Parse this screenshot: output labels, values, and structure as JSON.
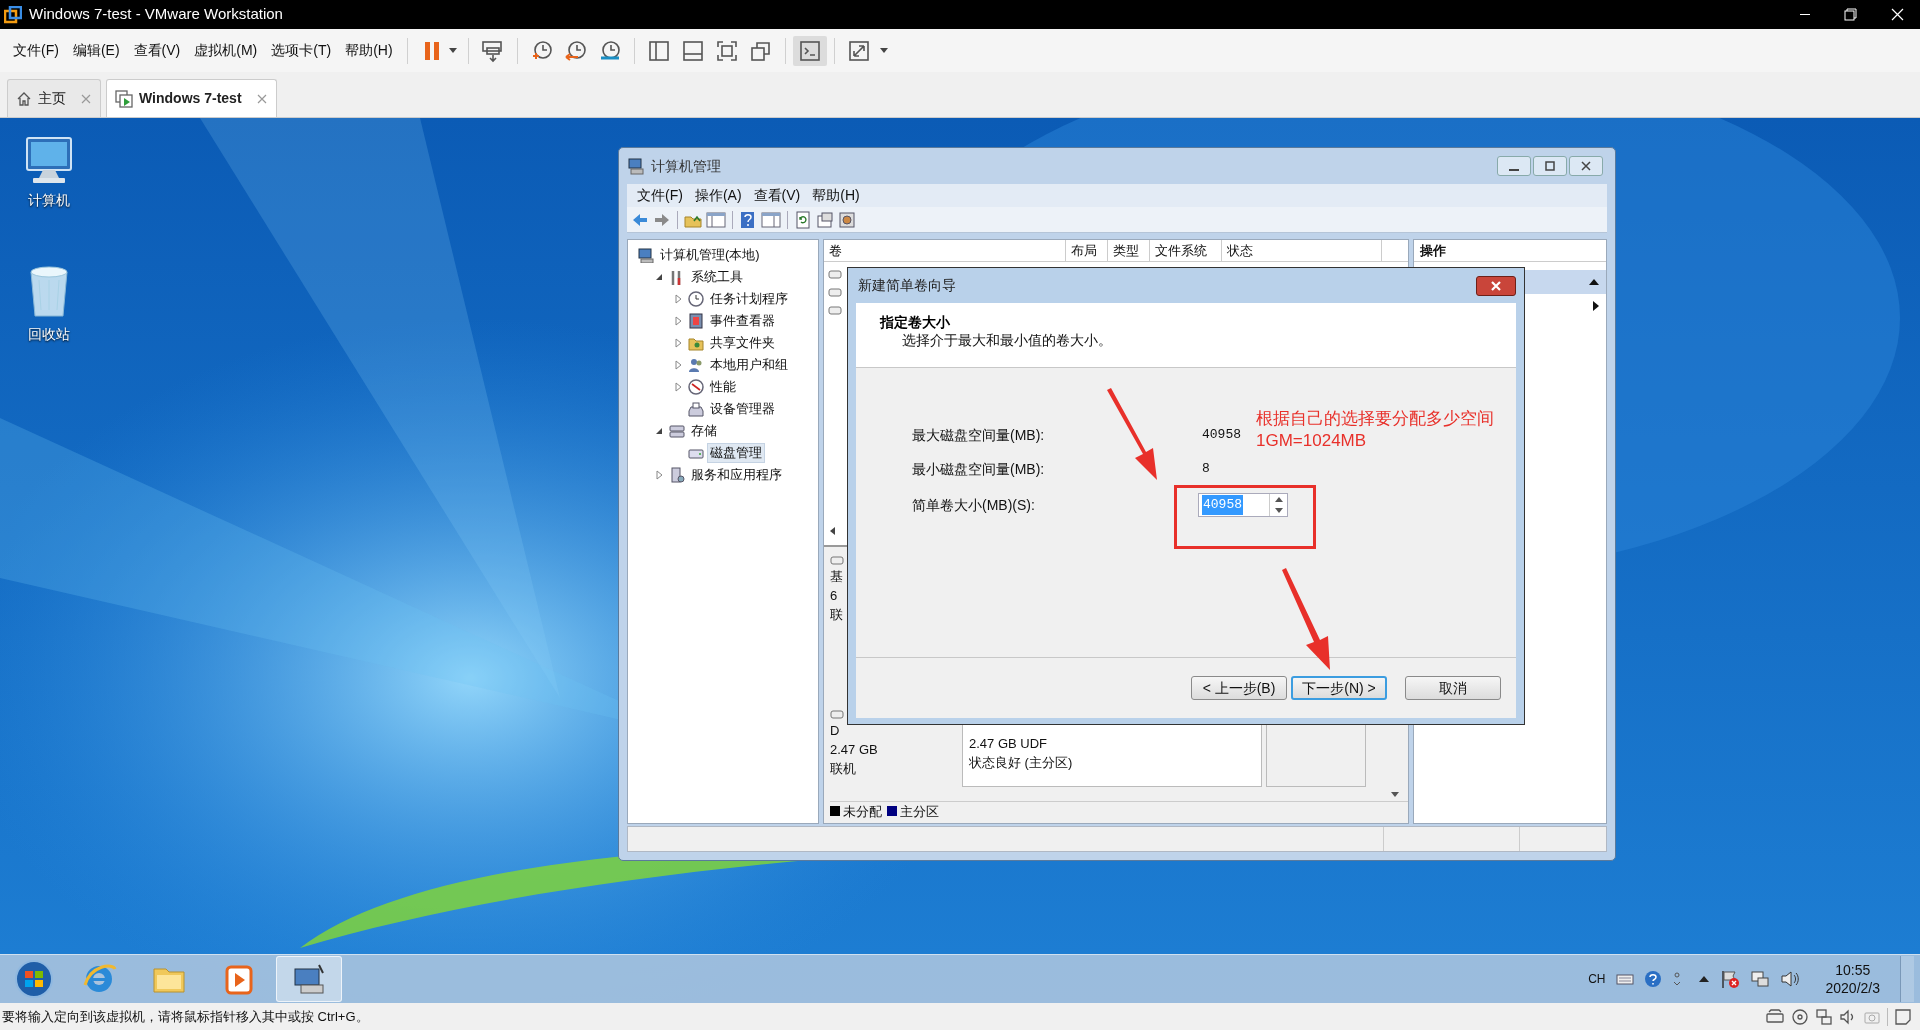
{
  "window": {
    "title": "Windows 7-test - VMware Workstation"
  },
  "menu": [
    "文件(F)",
    "编辑(E)",
    "查看(V)",
    "虚拟机(M)",
    "选项卡(T)",
    "帮助(H)"
  ],
  "tabs": [
    {
      "label": "主页",
      "selected": false
    },
    {
      "label": "Windows 7-test",
      "selected": true
    }
  ],
  "desktop_icons": [
    {
      "label": "计算机",
      "kind": "computer"
    },
    {
      "label": "回收站",
      "kind": "recycle"
    }
  ],
  "computer_management": {
    "title": "计算机管理",
    "menu": [
      "文件(F)",
      "操作(A)",
      "查看(V)",
      "帮助(H)"
    ],
    "tree": [
      {
        "label": "计算机管理(本地)",
        "kind": "computer",
        "selected": false,
        "children": [
          {
            "label": "系统工具",
            "kind": "tools",
            "expanded": true,
            "selected": false,
            "children": [
              {
                "label": "任务计划程序",
                "kind": "clock",
                "expanded": false,
                "selected": false
              },
              {
                "label": "事件查看器",
                "kind": "log",
                "expanded": false,
                "selected": false
              },
              {
                "label": "共享文件夹",
                "kind": "share",
                "expanded": false,
                "selected": false
              },
              {
                "label": "本地用户和组",
                "kind": "users",
                "expanded": false,
                "selected": false
              },
              {
                "label": "性能",
                "kind": "perf",
                "expanded": false,
                "selected": false
              },
              {
                "label": "设备管理器",
                "kind": "device",
                "selected": false
              }
            ]
          },
          {
            "label": "存储",
            "kind": "storage",
            "expanded": true,
            "selected": false,
            "children": [
              {
                "label": "磁盘管理",
                "kind": "disk",
                "selected": true
              }
            ]
          },
          {
            "label": "服务和应用程序",
            "kind": "services",
            "expanded": false,
            "selected": false
          }
        ]
      }
    ],
    "columns": [
      "卷",
      "布局",
      "类型",
      "文件系统",
      "状态"
    ],
    "disks": [
      {
        "lines": [
          "基",
          "6",
          "联"
        ]
      },
      {
        "lines": [
          "D",
          "2.47 GB",
          "联机"
        ],
        "partition": [
          "2.47 GB UDF",
          "状态良好 (主分区)"
        ]
      }
    ],
    "legend": [
      {
        "label": "未分配",
        "color": "#000000"
      },
      {
        "label": "主分区",
        "color": "#000080"
      }
    ],
    "actions": {
      "header": "操作"
    }
  },
  "wizard": {
    "title": "新建简单卷向导",
    "heading": "指定卷大小",
    "subheading": "选择介于最大和最小值的卷大小。",
    "fields": [
      {
        "label": "最大磁盘空间量(MB):",
        "value": "40958"
      },
      {
        "label": "最小磁盘空间量(MB):",
        "value": "8"
      }
    ],
    "size_field": {
      "label": "简单卷大小(MB)(S):",
      "value": "40958",
      "text_selected": true
    },
    "annotation": [
      "根据自己的选择要分配多少空间",
      "1GM=1024MB"
    ],
    "buttons": [
      {
        "label": "< 上一步(B)",
        "default": false
      },
      {
        "label": "下一步(N) >",
        "default": true
      },
      {
        "label": "取消",
        "default": false
      }
    ]
  },
  "taskbar": {
    "items": [
      {
        "kind": "browser",
        "active": false
      },
      {
        "kind": "folder",
        "active": false
      },
      {
        "kind": "media",
        "active": false
      },
      {
        "kind": "app",
        "active": true
      }
    ],
    "language": "CH",
    "time": "10:55",
    "date": "2020/2/3"
  },
  "status_bar": {
    "text": "要将输入定向到该虚拟机，请将鼠标指针移入其中或按 Ctrl+G。"
  }
}
